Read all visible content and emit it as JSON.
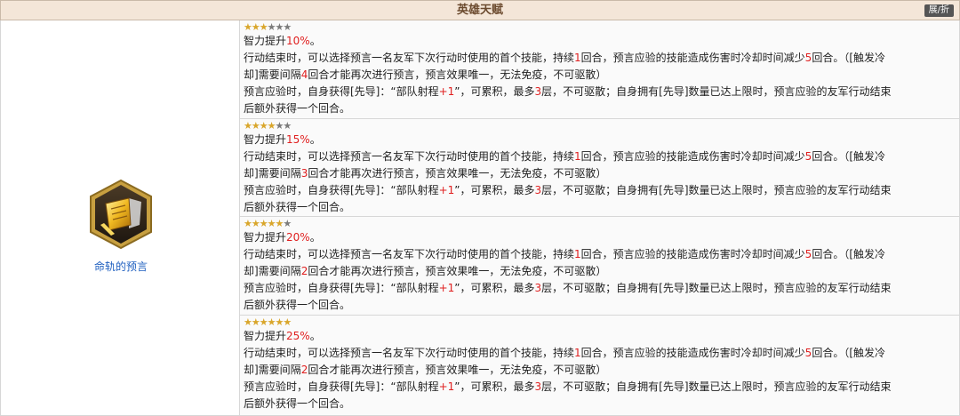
{
  "header": {
    "title": "英雄天赋",
    "toggle_label": "展/折"
  },
  "talent": {
    "name": "命轨的预言",
    "icon": "golden-scroll-icon"
  },
  "colors": {
    "highlight": "#e02020",
    "star_on": "#d9a62b",
    "star_off": "#7b7b7b",
    "header_bg": "#f4e6d8",
    "link": "#2060c0"
  },
  "text": {
    "l2a": "行动结束时，可以选择预言一名友军下次行动时使用的首个技能，持续",
    "l2b": "回合，预言应验的技能造成伤害时冷却时间减少",
    "l2c": "回合。（[触发冷",
    "l3a": "却]需要间隔",
    "l3b": "回合才能再次进行预言，预言效果唯一，无法免疫，不可驱散）",
    "l4a": "预言应验时，自身获得[先导]：“部队射程",
    "l4b": "”，可累积，最多",
    "l4c": "层，不可驱散；自身拥有[先导]数量已达上限时，预言应验的友军行动结束",
    "l5": "后额外获得一个回合。"
  },
  "levels": [
    {
      "stars_filled": 3,
      "stars_total": 6,
      "prefix": "智力提升",
      "pct": "10%",
      "suffix": "。",
      "duration": "1",
      "cd_reduce": "5",
      "interval": "4",
      "range": "+1",
      "max_layers": "3"
    },
    {
      "stars_filled": 4,
      "stars_total": 6,
      "prefix": "智力提升",
      "pct": "15%",
      "suffix": "。",
      "duration": "1",
      "cd_reduce": "5",
      "interval": "3",
      "range": "+1",
      "max_layers": "3"
    },
    {
      "stars_filled": 5,
      "stars_total": 6,
      "prefix": "智力提升",
      "pct": "20%",
      "suffix": "。",
      "duration": "1",
      "cd_reduce": "5",
      "interval": "2",
      "range": "+1",
      "max_layers": "3"
    },
    {
      "stars_filled": 6,
      "stars_total": 6,
      "prefix": "智力提升",
      "pct": "25%",
      "suffix": "。",
      "duration": "1",
      "cd_reduce": "5",
      "interval": "2",
      "range": "+1",
      "max_layers": "3"
    }
  ]
}
